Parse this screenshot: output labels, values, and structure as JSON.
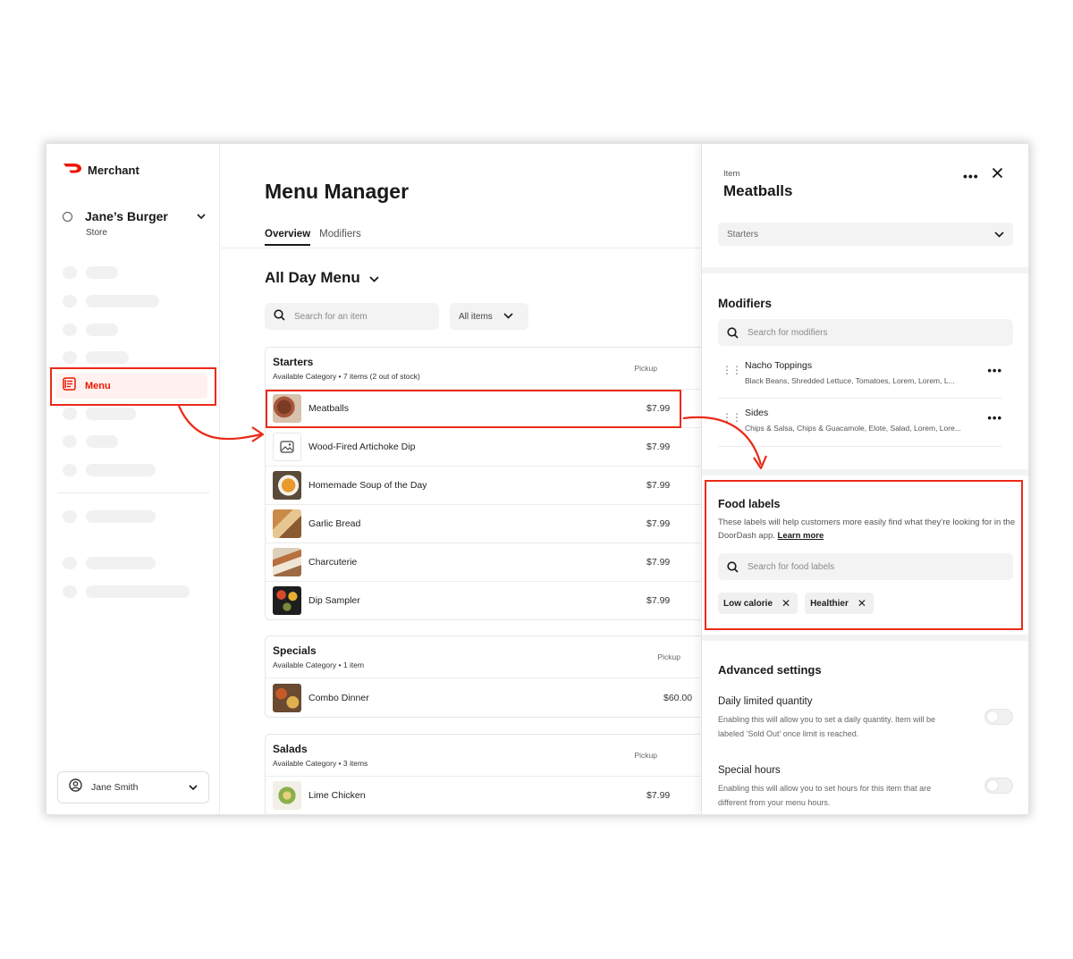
{
  "brand": {
    "name": "Merchant"
  },
  "store": {
    "name": "Jane’s Burger",
    "type": "Store"
  },
  "sidebar": {
    "active_item": "Menu"
  },
  "user": {
    "name": "Jane Smith"
  },
  "main": {
    "title": "Menu Manager",
    "tabs": [
      {
        "label": "Overview",
        "active": true
      },
      {
        "label": "Modifiers",
        "active": false
      }
    ],
    "menu_name": "All Day Menu",
    "search_placeholder": "Search for an item",
    "filter_label": "All items",
    "categories": [
      {
        "name": "Starters",
        "subtitle": "Available Category  •  7 items (2 out of stock)",
        "pickup": "Pickup",
        "items": [
          {
            "name": "Meatballs",
            "price": "$7.99"
          },
          {
            "name": "Wood-Fired Artichoke Dip",
            "price": "$7.99"
          },
          {
            "name": "Homemade Soup of the Day",
            "price": "$7.99"
          },
          {
            "name": "Garlic Bread",
            "price": "$7.99"
          },
          {
            "name": "Charcuterie",
            "price": "$7.99"
          },
          {
            "name": "Dip Sampler",
            "price": "$7.99"
          }
        ]
      },
      {
        "name": "Specials",
        "subtitle": "Available Category  •  1 item",
        "pickup": "Pickup",
        "items": [
          {
            "name": "Combo Dinner",
            "price": "$60.00"
          }
        ]
      },
      {
        "name": "Salads",
        "subtitle": "Available Category  •  3 items",
        "pickup": "Pickup",
        "items": [
          {
            "name": "Lime Chicken",
            "price": "$7.99"
          }
        ]
      }
    ]
  },
  "panel": {
    "kicker": "Item",
    "title": "Meatballs",
    "category_select": "Starters",
    "modifiers": {
      "title": "Modifiers",
      "search_placeholder": "Search for modifiers",
      "items": [
        {
          "name": "Nacho Toppings",
          "desc": "Black Beans, Shredded Lettuce, Tomatoes, Lorem, Lorem, L..."
        },
        {
          "name": "Sides",
          "desc": "Chips & Salsa, Chips & Guacamole, Elote, Salad, Lorem, Lore..."
        }
      ]
    },
    "food_labels": {
      "title": "Food labels",
      "desc": "These labels will help customers more easily find what they’re looking for in the DoorDash app.",
      "link": "Learn more",
      "search_placeholder": "Search for food labels",
      "chips": [
        "Low calorie",
        "Healthier"
      ]
    },
    "advanced": {
      "title": "Advanced settings",
      "settings": [
        {
          "name": "Daily limited quantity",
          "desc": "Enabling this will allow you to set a daily quantity. Item will be labeled ‘Sold Out’ once limit is reached.",
          "enabled": false
        },
        {
          "name": "Special hours",
          "desc": "Enabling this will allow you to set hours for this item that are different from your menu hours.",
          "enabled": false
        }
      ]
    }
  },
  "colors": {
    "accent": "#eb1700",
    "highlight": "#eb2a17"
  }
}
